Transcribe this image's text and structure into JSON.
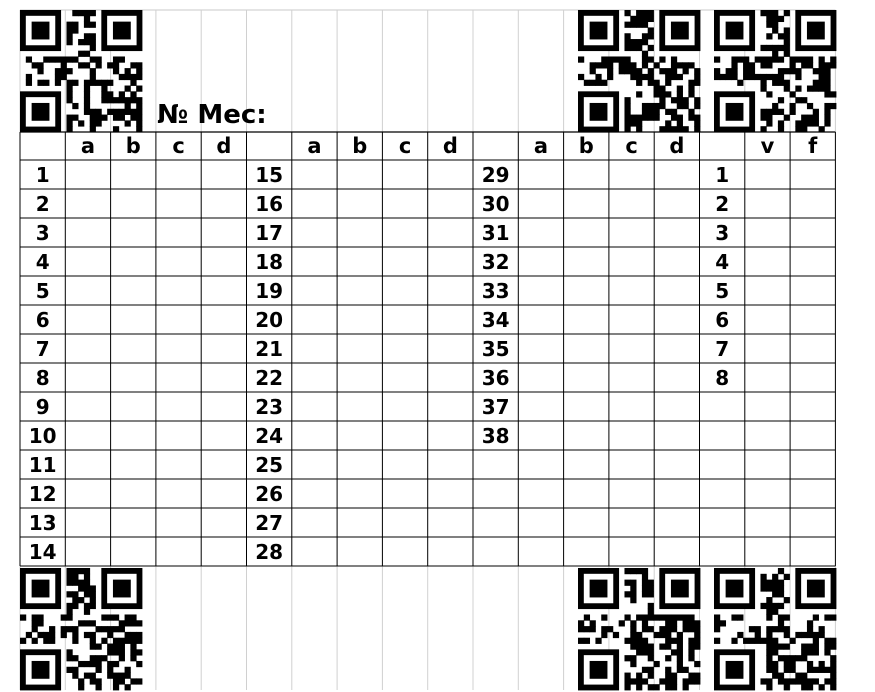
{
  "form": {
    "title": "№ Мес:",
    "header_letters": [
      "a",
      "b",
      "c",
      "d",
      "a",
      "b",
      "c",
      "d",
      "a",
      "b",
      "c",
      "d",
      "v",
      "f"
    ],
    "question_blocks": [
      [
        "1",
        "2",
        "3",
        "4",
        "5",
        "6",
        "7",
        "8",
        "9",
        "10",
        "11",
        "12",
        "13",
        "14"
      ],
      [
        "15",
        "16",
        "17",
        "18",
        "19",
        "20",
        "21",
        "22",
        "23",
        "24",
        "25",
        "26",
        "27",
        "28"
      ],
      [
        "29",
        "30",
        "31",
        "32",
        "33",
        "34",
        "35",
        "36",
        "37",
        "38"
      ],
      [
        "1",
        "2",
        "3",
        "4",
        "5",
        "6",
        "7",
        "8"
      ]
    ],
    "markers": [
      "qr-top-left",
      "qr-top-right-1",
      "qr-top-right-2",
      "qr-bottom-left",
      "qr-bottom-right-1",
      "qr-bottom-right-2"
    ]
  }
}
